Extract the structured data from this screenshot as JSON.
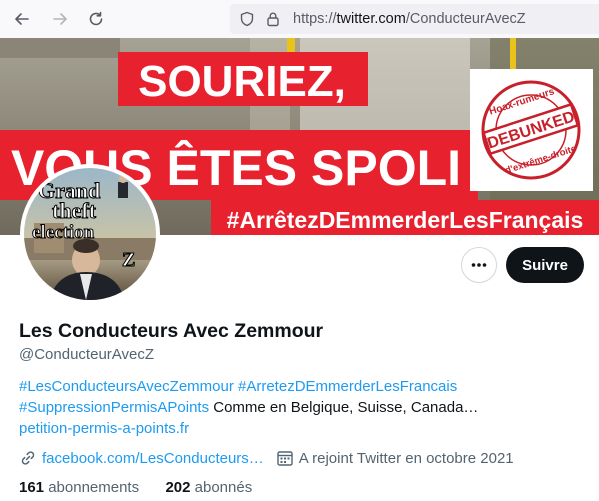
{
  "browser": {
    "back_icon": "arrow-left-icon",
    "forward_icon": "arrow-right-icon",
    "reload_icon": "reload-icon",
    "tracking_icon": "shield-icon",
    "lock_icon": "lock-icon",
    "url_scheme": "https://",
    "url_host": "twitter.com",
    "url_path": "/ConducteurAvecZ"
  },
  "banner": {
    "headline_1": "SOURIEZ,",
    "headline_2": "VOUS ÊTES SPOLI",
    "hashtag": "#ArrêtezDEmmerderLesFrançais",
    "stamp": {
      "text": "DEBUNKED",
      "top_text": "Hoax-rumeurs",
      "bottom_text": "d'extrême-droite"
    }
  },
  "avatar": {
    "line_1": "Grand",
    "line_2": "theft",
    "line_3": "election",
    "badge": "Z"
  },
  "actions": {
    "more_icon": "more-horizontal-icon",
    "follow_label": "Suivre"
  },
  "profile": {
    "name": "Les Conducteurs Avec Zemmour",
    "handle": "@ConducteurAvecZ",
    "bio_hashtag_1": "#LesConducteursAvecZemmour",
    "bio_hashtag_2": "#ArretezDEmmerderLesFrancais",
    "bio_hashtag_3": "#SuppressionPermisAPoints",
    "bio_text": " Comme en Belgique, Suisse, Canada…",
    "bio_link": "petition-permis-a-points.fr",
    "website": "facebook.com/LesConducteurs…",
    "joined": "A rejoint Twitter en octobre 2021",
    "following_count": "161",
    "following_label": " abonnements",
    "followers_count": "202",
    "followers_label": " abonnés"
  },
  "colors": {
    "accent": "#1d9bf0",
    "banner_red": "#e8212e",
    "stamp_red": "#c8202a",
    "text_primary": "#0f1419",
    "text_secondary": "#536471"
  }
}
